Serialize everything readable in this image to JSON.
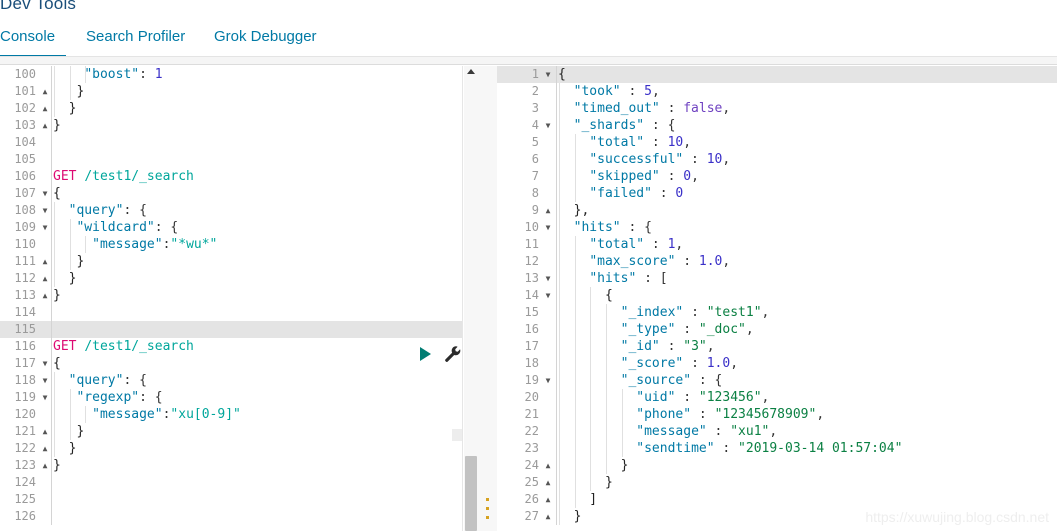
{
  "app": {
    "title": "Dev Tools",
    "watermark": "https://xuwujing.blog.csdn.net"
  },
  "tabs": [
    {
      "label": "Console",
      "active": true
    },
    {
      "label": "Search Profiler",
      "active": false
    },
    {
      "label": "Grok Debugger",
      "active": false
    }
  ],
  "colors": {
    "accent": "#0079a5",
    "method": "#dd0a73",
    "url": "#00a69b",
    "key": "#0079a5",
    "string": "#00a69b",
    "response_string": "#0b8043",
    "number": "#3a30c8",
    "boolean": "#6f42c1",
    "active_line": "#e4e4e4",
    "play_button": "#017d73"
  },
  "request_editor": {
    "name": "console-request-editor",
    "first_visible_line": 100,
    "active_line": 115,
    "lines": [
      {
        "num": 100,
        "fold": "",
        "indent": 3,
        "text": "    \"boost\": 1",
        "tokens": [
          {
            "t": "    ",
            "c": "k-punct"
          },
          {
            "t": "\"boost\"",
            "c": "k-key"
          },
          {
            "t": ": ",
            "c": "k-punct"
          },
          {
            "t": "1",
            "c": "k-num"
          }
        ]
      },
      {
        "num": 101,
        "fold": "close",
        "indent": 2,
        "text": "   }",
        "tokens": [
          {
            "t": "   }",
            "c": "k-brace"
          }
        ]
      },
      {
        "num": 102,
        "fold": "close",
        "indent": 1,
        "text": "  }",
        "tokens": [
          {
            "t": "  }",
            "c": "k-brace"
          }
        ]
      },
      {
        "num": 103,
        "fold": "close",
        "indent": 0,
        "text": "}",
        "tokens": [
          {
            "t": "}",
            "c": "k-brace"
          }
        ]
      },
      {
        "num": 104,
        "fold": "",
        "indent": 0,
        "text": "",
        "tokens": []
      },
      {
        "num": 105,
        "fold": "",
        "indent": 0,
        "text": "",
        "tokens": []
      },
      {
        "num": 106,
        "fold": "",
        "indent": 0,
        "text": "GET /test1/_search",
        "tokens": [
          {
            "t": "GET",
            "c": "k-method"
          },
          {
            "t": " ",
            "c": "k-punct"
          },
          {
            "t": "/test1/_search",
            "c": "k-url"
          }
        ]
      },
      {
        "num": 107,
        "fold": "open",
        "indent": 0,
        "text": "{",
        "tokens": [
          {
            "t": "{",
            "c": "k-brace"
          }
        ]
      },
      {
        "num": 108,
        "fold": "open",
        "indent": 1,
        "text": "  \"query\": {",
        "tokens": [
          {
            "t": "  ",
            "c": "k-punct"
          },
          {
            "t": "\"query\"",
            "c": "k-key"
          },
          {
            "t": ": {",
            "c": "k-punct"
          }
        ]
      },
      {
        "num": 109,
        "fold": "open",
        "indent": 2,
        "text": "   \"wildcard\": {",
        "tokens": [
          {
            "t": "   ",
            "c": "k-punct"
          },
          {
            "t": "\"wildcard\"",
            "c": "k-key"
          },
          {
            "t": ": {",
            "c": "k-punct"
          }
        ]
      },
      {
        "num": 110,
        "fold": "",
        "indent": 3,
        "text": "     \"message\":\"*wu*\"",
        "tokens": [
          {
            "t": "     ",
            "c": "k-punct"
          },
          {
            "t": "\"message\"",
            "c": "k-key"
          },
          {
            "t": ":",
            "c": "k-punct"
          },
          {
            "t": "\"*wu*\"",
            "c": "k-str"
          }
        ]
      },
      {
        "num": 111,
        "fold": "close",
        "indent": 2,
        "text": "   }",
        "tokens": [
          {
            "t": "   }",
            "c": "k-brace"
          }
        ]
      },
      {
        "num": 112,
        "fold": "close",
        "indent": 1,
        "text": "  }",
        "tokens": [
          {
            "t": "  }",
            "c": "k-brace"
          }
        ]
      },
      {
        "num": 113,
        "fold": "close",
        "indent": 0,
        "text": "}",
        "tokens": [
          {
            "t": "}",
            "c": "k-brace"
          }
        ]
      },
      {
        "num": 114,
        "fold": "",
        "indent": 0,
        "text": "",
        "tokens": []
      },
      {
        "num": 115,
        "fold": "",
        "indent": 0,
        "text": "",
        "tokens": []
      },
      {
        "num": 116,
        "fold": "",
        "indent": 0,
        "text": "GET /test1/_search",
        "tokens": [
          {
            "t": "GET",
            "c": "k-method"
          },
          {
            "t": " ",
            "c": "k-punct"
          },
          {
            "t": "/test1/_search",
            "c": "k-url"
          }
        ]
      },
      {
        "num": 117,
        "fold": "open",
        "indent": 0,
        "text": "{",
        "tokens": [
          {
            "t": "{",
            "c": "k-brace"
          }
        ]
      },
      {
        "num": 118,
        "fold": "open",
        "indent": 1,
        "text": "  \"query\": {",
        "tokens": [
          {
            "t": "  ",
            "c": "k-punct"
          },
          {
            "t": "\"query\"",
            "c": "k-key"
          },
          {
            "t": ": {",
            "c": "k-punct"
          }
        ]
      },
      {
        "num": 119,
        "fold": "open",
        "indent": 2,
        "text": "   \"regexp\": {",
        "tokens": [
          {
            "t": "   ",
            "c": "k-punct"
          },
          {
            "t": "\"regexp\"",
            "c": "k-key"
          },
          {
            "t": ": {",
            "c": "k-punct"
          }
        ]
      },
      {
        "num": 120,
        "fold": "",
        "indent": 3,
        "text": "     \"message\":\"xu[0-9]\"",
        "tokens": [
          {
            "t": "     ",
            "c": "k-punct"
          },
          {
            "t": "\"message\"",
            "c": "k-key"
          },
          {
            "t": ":",
            "c": "k-punct"
          },
          {
            "t": "\"xu[0-9]\"",
            "c": "k-str"
          }
        ]
      },
      {
        "num": 121,
        "fold": "close",
        "indent": 2,
        "text": "   }",
        "tokens": [
          {
            "t": "   }",
            "c": "k-brace"
          }
        ]
      },
      {
        "num": 122,
        "fold": "close",
        "indent": 1,
        "text": "  }",
        "tokens": [
          {
            "t": "  }",
            "c": "k-brace"
          }
        ]
      },
      {
        "num": 123,
        "fold": "close",
        "indent": 0,
        "text": "}",
        "tokens": [
          {
            "t": "}",
            "c": "k-brace"
          }
        ]
      },
      {
        "num": 124,
        "fold": "",
        "indent": 0,
        "text": "",
        "tokens": []
      },
      {
        "num": 125,
        "fold": "",
        "indent": 0,
        "text": "",
        "tokens": []
      },
      {
        "num": 126,
        "fold": "",
        "indent": 0,
        "text": "",
        "tokens": []
      }
    ]
  },
  "response_editor": {
    "name": "console-response-viewer",
    "active_line": 1,
    "lines": [
      {
        "num": 1,
        "fold": "open",
        "indent": 0,
        "text": "{",
        "tokens": [
          {
            "t": "{",
            "c": "k-brace"
          }
        ]
      },
      {
        "num": 2,
        "fold": "",
        "indent": 1,
        "text": "  \"took\" : 5,",
        "tokens": [
          {
            "t": "  ",
            "c": "k-punct"
          },
          {
            "t": "\"took\"",
            "c": "k-key"
          },
          {
            "t": " : ",
            "c": "k-punct"
          },
          {
            "t": "5",
            "c": "k-num"
          },
          {
            "t": ",",
            "c": "k-punct"
          }
        ]
      },
      {
        "num": 3,
        "fold": "",
        "indent": 1,
        "text": "  \"timed_out\" : false,",
        "tokens": [
          {
            "t": "  ",
            "c": "k-punct"
          },
          {
            "t": "\"timed_out\"",
            "c": "k-key"
          },
          {
            "t": " : ",
            "c": "k-punct"
          },
          {
            "t": "false",
            "c": "k-bool"
          },
          {
            "t": ",",
            "c": "k-punct"
          }
        ]
      },
      {
        "num": 4,
        "fold": "open",
        "indent": 1,
        "text": "  \"_shards\" : {",
        "tokens": [
          {
            "t": "  ",
            "c": "k-punct"
          },
          {
            "t": "\"_shards\"",
            "c": "k-key"
          },
          {
            "t": " : {",
            "c": "k-punct"
          }
        ]
      },
      {
        "num": 5,
        "fold": "",
        "indent": 2,
        "text": "    \"total\" : 10,",
        "tokens": [
          {
            "t": "    ",
            "c": "k-punct"
          },
          {
            "t": "\"total\"",
            "c": "k-key"
          },
          {
            "t": " : ",
            "c": "k-punct"
          },
          {
            "t": "10",
            "c": "k-num"
          },
          {
            "t": ",",
            "c": "k-punct"
          }
        ]
      },
      {
        "num": 6,
        "fold": "",
        "indent": 2,
        "text": "    \"successful\" : 10,",
        "tokens": [
          {
            "t": "    ",
            "c": "k-punct"
          },
          {
            "t": "\"successful\"",
            "c": "k-key"
          },
          {
            "t": " : ",
            "c": "k-punct"
          },
          {
            "t": "10",
            "c": "k-num"
          },
          {
            "t": ",",
            "c": "k-punct"
          }
        ]
      },
      {
        "num": 7,
        "fold": "",
        "indent": 2,
        "text": "    \"skipped\" : 0,",
        "tokens": [
          {
            "t": "    ",
            "c": "k-punct"
          },
          {
            "t": "\"skipped\"",
            "c": "k-key"
          },
          {
            "t": " : ",
            "c": "k-punct"
          },
          {
            "t": "0",
            "c": "k-num"
          },
          {
            "t": ",",
            "c": "k-punct"
          }
        ]
      },
      {
        "num": 8,
        "fold": "",
        "indent": 2,
        "text": "    \"failed\" : 0",
        "tokens": [
          {
            "t": "    ",
            "c": "k-punct"
          },
          {
            "t": "\"failed\"",
            "c": "k-key"
          },
          {
            "t": " : ",
            "c": "k-punct"
          },
          {
            "t": "0",
            "c": "k-num"
          }
        ]
      },
      {
        "num": 9,
        "fold": "close",
        "indent": 1,
        "text": "  },",
        "tokens": [
          {
            "t": "  },",
            "c": "k-brace"
          }
        ]
      },
      {
        "num": 10,
        "fold": "open",
        "indent": 1,
        "text": "  \"hits\" : {",
        "tokens": [
          {
            "t": "  ",
            "c": "k-punct"
          },
          {
            "t": "\"hits\"",
            "c": "k-key"
          },
          {
            "t": " : {",
            "c": "k-punct"
          }
        ]
      },
      {
        "num": 11,
        "fold": "",
        "indent": 2,
        "text": "    \"total\" : 1,",
        "tokens": [
          {
            "t": "    ",
            "c": "k-punct"
          },
          {
            "t": "\"total\"",
            "c": "k-key"
          },
          {
            "t": " : ",
            "c": "k-punct"
          },
          {
            "t": "1",
            "c": "k-num"
          },
          {
            "t": ",",
            "c": "k-punct"
          }
        ]
      },
      {
        "num": 12,
        "fold": "",
        "indent": 2,
        "text": "    \"max_score\" : 1.0,",
        "tokens": [
          {
            "t": "    ",
            "c": "k-punct"
          },
          {
            "t": "\"max_score\"",
            "c": "k-key"
          },
          {
            "t": " : ",
            "c": "k-punct"
          },
          {
            "t": "1.0",
            "c": "k-num"
          },
          {
            "t": ",",
            "c": "k-punct"
          }
        ]
      },
      {
        "num": 13,
        "fold": "open",
        "indent": 2,
        "text": "    \"hits\" : [",
        "tokens": [
          {
            "t": "    ",
            "c": "k-punct"
          },
          {
            "t": "\"hits\"",
            "c": "k-key"
          },
          {
            "t": " : [",
            "c": "k-punct"
          }
        ]
      },
      {
        "num": 14,
        "fold": "open",
        "indent": 3,
        "text": "      {",
        "tokens": [
          {
            "t": "      {",
            "c": "k-brace"
          }
        ]
      },
      {
        "num": 15,
        "fold": "",
        "indent": 4,
        "text": "        \"_index\" : \"test1\",",
        "tokens": [
          {
            "t": "        ",
            "c": "k-punct"
          },
          {
            "t": "\"_index\"",
            "c": "k-key"
          },
          {
            "t": " : ",
            "c": "k-punct"
          },
          {
            "t": "\"test1\"",
            "c": "k-rstr"
          },
          {
            "t": ",",
            "c": "k-punct"
          }
        ]
      },
      {
        "num": 16,
        "fold": "",
        "indent": 4,
        "text": "        \"_type\" : \"_doc\",",
        "tokens": [
          {
            "t": "        ",
            "c": "k-punct"
          },
          {
            "t": "\"_type\"",
            "c": "k-key"
          },
          {
            "t": " : ",
            "c": "k-punct"
          },
          {
            "t": "\"_doc\"",
            "c": "k-rstr"
          },
          {
            "t": ",",
            "c": "k-punct"
          }
        ]
      },
      {
        "num": 17,
        "fold": "",
        "indent": 4,
        "text": "        \"_id\" : \"3\",",
        "tokens": [
          {
            "t": "        ",
            "c": "k-punct"
          },
          {
            "t": "\"_id\"",
            "c": "k-key"
          },
          {
            "t": " : ",
            "c": "k-punct"
          },
          {
            "t": "\"3\"",
            "c": "k-rstr"
          },
          {
            "t": ",",
            "c": "k-punct"
          }
        ]
      },
      {
        "num": 18,
        "fold": "",
        "indent": 4,
        "text": "        \"_score\" : 1.0,",
        "tokens": [
          {
            "t": "        ",
            "c": "k-punct"
          },
          {
            "t": "\"_score\"",
            "c": "k-key"
          },
          {
            "t": " : ",
            "c": "k-punct"
          },
          {
            "t": "1.0",
            "c": "k-num"
          },
          {
            "t": ",",
            "c": "k-punct"
          }
        ]
      },
      {
        "num": 19,
        "fold": "open",
        "indent": 4,
        "text": "        \"_source\" : {",
        "tokens": [
          {
            "t": "        ",
            "c": "k-punct"
          },
          {
            "t": "\"_source\"",
            "c": "k-key"
          },
          {
            "t": " : {",
            "c": "k-punct"
          }
        ]
      },
      {
        "num": 20,
        "fold": "",
        "indent": 5,
        "text": "          \"uid\" : \"123456\",",
        "tokens": [
          {
            "t": "          ",
            "c": "k-punct"
          },
          {
            "t": "\"uid\"",
            "c": "k-key"
          },
          {
            "t": " : ",
            "c": "k-punct"
          },
          {
            "t": "\"123456\"",
            "c": "k-rstr"
          },
          {
            "t": ",",
            "c": "k-punct"
          }
        ]
      },
      {
        "num": 21,
        "fold": "",
        "indent": 5,
        "text": "          \"phone\" : \"12345678909\",",
        "tokens": [
          {
            "t": "          ",
            "c": "k-punct"
          },
          {
            "t": "\"phone\"",
            "c": "k-key"
          },
          {
            "t": " : ",
            "c": "k-punct"
          },
          {
            "t": "\"12345678909\"",
            "c": "k-rstr"
          },
          {
            "t": ",",
            "c": "k-punct"
          }
        ]
      },
      {
        "num": 22,
        "fold": "",
        "indent": 5,
        "text": "          \"message\" : \"xu1\",",
        "tokens": [
          {
            "t": "          ",
            "c": "k-punct"
          },
          {
            "t": "\"message\"",
            "c": "k-key"
          },
          {
            "t": " : ",
            "c": "k-punct"
          },
          {
            "t": "\"xu1\"",
            "c": "k-rstr"
          },
          {
            "t": ",",
            "c": "k-punct"
          }
        ]
      },
      {
        "num": 23,
        "fold": "",
        "indent": 5,
        "text": "          \"sendtime\" : \"2019-03-14 01:57:04\"",
        "tokens": [
          {
            "t": "          ",
            "c": "k-punct"
          },
          {
            "t": "\"sendtime\"",
            "c": "k-key"
          },
          {
            "t": " : ",
            "c": "k-punct"
          },
          {
            "t": "\"2019-03-14 01:57:04\"",
            "c": "k-rstr"
          }
        ]
      },
      {
        "num": 24,
        "fold": "close",
        "indent": 4,
        "text": "        }",
        "tokens": [
          {
            "t": "        }",
            "c": "k-brace"
          }
        ]
      },
      {
        "num": 25,
        "fold": "close",
        "indent": 3,
        "text": "      }",
        "tokens": [
          {
            "t": "      }",
            "c": "k-brace"
          }
        ]
      },
      {
        "num": 26,
        "fold": "close",
        "indent": 2,
        "text": "    ]",
        "tokens": [
          {
            "t": "    ]",
            "c": "k-brace"
          }
        ]
      },
      {
        "num": 27,
        "fold": "close",
        "indent": 1,
        "text": "  }",
        "tokens": [
          {
            "t": "  }",
            "c": "k-brace"
          }
        ]
      }
    ]
  },
  "actions": {
    "play": "send-request",
    "wrench": "request-options"
  }
}
